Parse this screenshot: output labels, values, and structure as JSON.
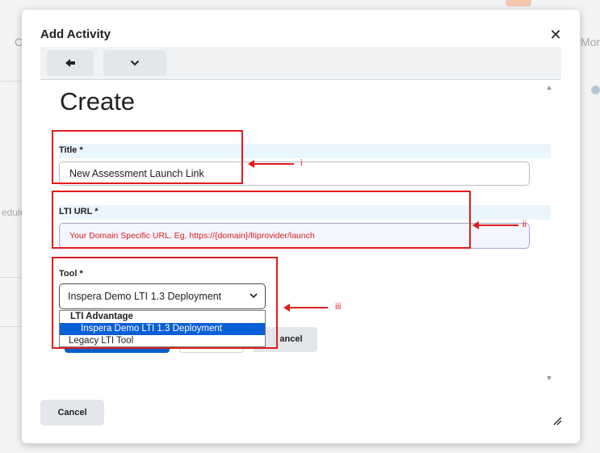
{
  "background": {
    "left_nav_letter": "C",
    "left_nav_text": "edule",
    "right_tab_text": "Mon"
  },
  "dialog": {
    "title": "Add Activity",
    "close_icon": "close-icon",
    "toolbar": {
      "back_icon": "back-arrow-icon",
      "menu_icon": "chevron-down-icon"
    }
  },
  "form": {
    "heading": "Create",
    "title_field": {
      "label": "Title *",
      "value": "New Assessment Launch Link"
    },
    "url_field": {
      "label": "LTI URL *",
      "placeholder": "Your Domain Specific URL. Eg. https://{domain}/ltiprovider/launch"
    },
    "tool_field": {
      "label": "Tool *",
      "selected": "Inspera Demo LTI 1.3 Deployment",
      "options": [
        {
          "label": "LTI Advantage",
          "group": true
        },
        {
          "label": "Inspera Demo LTI 1.3 Deployment",
          "selected": true
        },
        {
          "label": "Legacy LTI Tool"
        }
      ]
    },
    "inline_cancel_label": "ancel"
  },
  "annotations": {
    "i": "i",
    "ii": "ii",
    "iii": "iii",
    "color": "#e01c1c"
  },
  "footer": {
    "cancel_label": "Cancel"
  }
}
